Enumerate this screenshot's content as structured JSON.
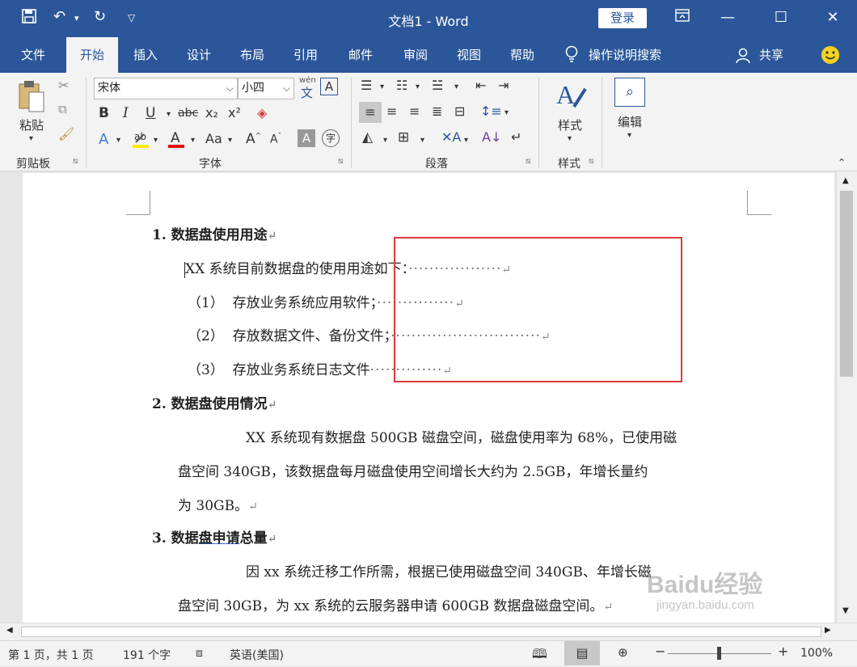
{
  "titlebar": {
    "title": "文档1  -  Word",
    "login": "登录"
  },
  "tabs": [
    "文件",
    "开始",
    "插入",
    "设计",
    "布局",
    "引用",
    "邮件",
    "审阅",
    "视图",
    "帮助"
  ],
  "search_label": "操作说明搜索",
  "share_label": "共享",
  "ribbon": {
    "paste": "粘贴",
    "font_name": "宋体",
    "font_size": "小四",
    "wen": "wén",
    "wen_char": "文",
    "bold": "B",
    "italic": "I",
    "underline": "U",
    "strike": "abc",
    "sub": "x₂",
    "sup": "x²",
    "aa": "Aa",
    "styles": "样式",
    "editing": "编辑",
    "group_clipboard": "剪贴板",
    "group_font": "字体",
    "group_paragraph": "段落",
    "group_styles": "样式"
  },
  "doc": {
    "h1": "1.  数据盘使用用途",
    "p1": "XX 系统目前数据盘的使用用途如下：",
    "p1_dots": "··················",
    "l1_num": "（1）",
    "l1": "存放业务系统应用软件；",
    "l1_dots": "···············",
    "l2_num": "（2）",
    "l2": "存放数据文件、备份文件；",
    "l2_dots": "·····························",
    "l3_num": "（3）",
    "l3": "存放业务系统日志文件",
    "l3_dots": "··············",
    "h2": "2. 数据盘使用情况",
    "p2a": "XX 系统现有数据盘 500GB 磁盘空间，磁盘使用率为 68%，已使用磁",
    "p2b": "盘空间 340GB，该数据盘每月磁盘使用空间增长大约为 2.5GB，年增长量约",
    "p2c": "为 30GB。",
    "h3_a": "3. 数据",
    "h3_b": "盘申请",
    "h3_c": "总量",
    "p3a": "因 xx 系统迁移工作所需，根据已使用磁盘空间 340GB、年增长磁",
    "p3b": "盘空间 30GB，为 xx 系统的云服务器申请 600GB 数据盘磁盘空间。",
    "para_mark": "↵"
  },
  "status": {
    "page": "第 1 页，共 1 页",
    "words": "191 个字",
    "lang": "英语(美国)",
    "zoom": "100%"
  },
  "watermark": {
    "line1": "Baidu经验",
    "line2": "jingyan.baidu.com"
  }
}
